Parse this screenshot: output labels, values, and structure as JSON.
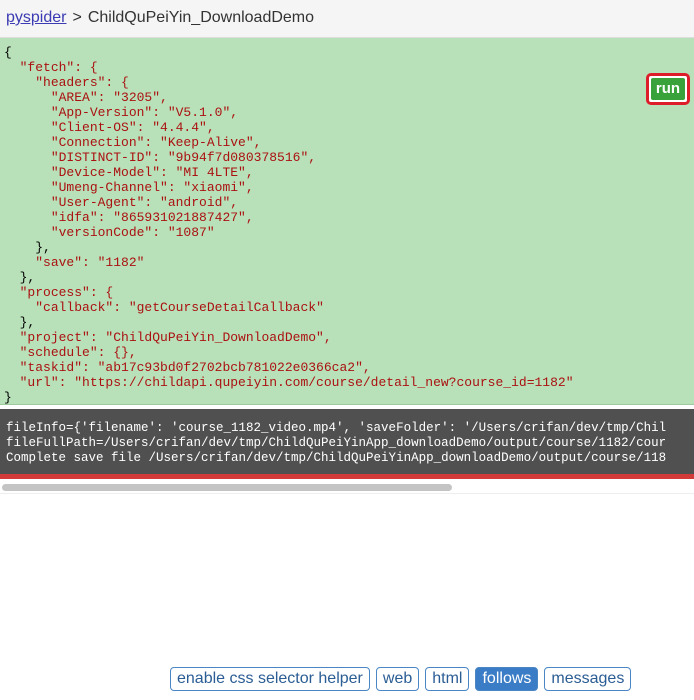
{
  "breadcrumb": {
    "home": "pyspider",
    "separator": ">",
    "project": "ChildQuPeiYin_DownloadDemo"
  },
  "run_label": "run",
  "nav": {
    "prev": "<",
    "divider": "|",
    "next": ">"
  },
  "task_json_lines": [
    "{",
    "  \"fetch\": {",
    "    \"headers\": {",
    "      \"AREA\": \"3205\",",
    "      \"App-Version\": \"V5.1.0\",",
    "      \"Client-OS\": \"4.4.4\",",
    "      \"Connection\": \"Keep-Alive\",",
    "      \"DISTINCT-ID\": \"9b94f7d080378516\",",
    "      \"Device-Model\": \"MI 4LTE\",",
    "      \"Umeng-Channel\": \"xiaomi\",",
    "      \"User-Agent\": \"android\",",
    "      \"idfa\": \"865931021887427\",",
    "      \"versionCode\": \"1087\"",
    "    },",
    "    \"save\": \"1182\"",
    "  },",
    "  \"process\": {",
    "    \"callback\": \"getCourseDetailCallback\"",
    "  },",
    "  \"project\": \"ChildQuPeiYin_DownloadDemo\",",
    "  \"schedule\": {},",
    "  \"taskid\": \"ab17c93bd0f2702bcb781022e0366ca2\",",
    "  \"url\": \"https://childapi.qupeiyin.com/course/detail_new?course_id=1182\"",
    "}"
  ],
  "console_lines": [
    "fileInfo={'filename': 'course_1182_video.mp4', 'saveFolder': '/Users/crifan/dev/tmp/Chil",
    "fileFullPath=/Users/crifan/dev/tmp/ChildQuPeiYinApp_downloadDemo/output/course/1182/cour",
    "Complete save file /Users/crifan/dev/tmp/ChildQuPeiYinApp_downloadDemo/output/course/118"
  ],
  "tabs": [
    {
      "label": "enable css selector helper",
      "active": false
    },
    {
      "label": "web",
      "active": false
    },
    {
      "label": "html",
      "active": false
    },
    {
      "label": "follows",
      "active": true
    },
    {
      "label": "messages",
      "active": false
    }
  ],
  "colors": {
    "task_bg": "#b9e1b9",
    "run_button": "#3aa23a",
    "run_highlight": "#dd1e2a",
    "console_bg": "#505050",
    "tab_active": "#3a7cc5"
  }
}
